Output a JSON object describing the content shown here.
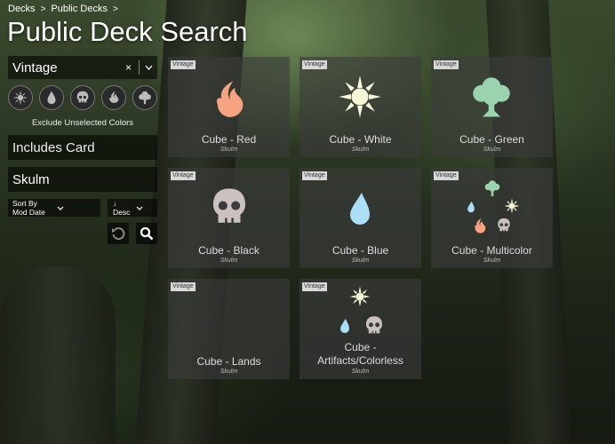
{
  "breadcrumb": {
    "items": [
      "Decks",
      "Public Decks"
    ],
    "separator": ">"
  },
  "page_title": "Public Deck Search",
  "filters": {
    "format_value": "Vintage",
    "clear_glyph": "×",
    "colors": [
      {
        "name": "white",
        "icon": "sun-icon",
        "color": "#f8f6d8"
      },
      {
        "name": "blue",
        "icon": "water-drop-icon",
        "color": "#aadff5"
      },
      {
        "name": "black",
        "icon": "skull-icon",
        "color": "#cbc2bf"
      },
      {
        "name": "red",
        "icon": "fire-icon",
        "color": "#f5a380"
      },
      {
        "name": "green",
        "icon": "tree-icon",
        "color": "#9bd3ae"
      }
    ],
    "exclude_label": "Exclude Unselected Colors",
    "includes_card_placeholder": "Includes Card",
    "owner_value": "Skulm",
    "sort_by_value": "Sort By Mod Date",
    "sort_dir_value": "↓ Desc"
  },
  "decks": [
    {
      "badge": "Vintage",
      "title": "Cube - Red",
      "owner": "Skulm",
      "icons": [
        "fire-icon"
      ]
    },
    {
      "badge": "Vintage",
      "title": "Cube - White",
      "owner": "Skulm",
      "icons": [
        "sun-icon"
      ]
    },
    {
      "badge": "Vintage",
      "title": "Cube - Green",
      "owner": "Skulm",
      "icons": [
        "tree-icon"
      ]
    },
    {
      "badge": "Vintage",
      "title": "Cube - Black",
      "owner": "Skulm",
      "icons": [
        "skull-icon"
      ]
    },
    {
      "badge": "Vintage",
      "title": "Cube - Blue",
      "owner": "Skulm",
      "icons": [
        "water-drop-icon"
      ]
    },
    {
      "badge": "Vintage",
      "title": "Cube - Multicolor",
      "owner": "Skulm",
      "icons": [
        "tree-icon",
        "water-drop-icon",
        "sun-icon",
        "fire-icon",
        "skull-icon"
      ]
    },
    {
      "badge": "Vintage",
      "title": "Cube - Lands",
      "owner": "Skulm",
      "icons": []
    },
    {
      "badge": "Vintage",
      "title": "Cube - Artifacts/Colorless",
      "owner": "Skulm",
      "icons": [
        "sun-icon",
        "water-drop-icon",
        "skull-icon"
      ]
    }
  ],
  "colors": {
    "red": "#f5a380",
    "white": "#f8f6d8",
    "green": "#9bd3ae",
    "black": "#cbc2bf",
    "blue": "#aadff5",
    "badge_bg": "#d8d8d8"
  }
}
